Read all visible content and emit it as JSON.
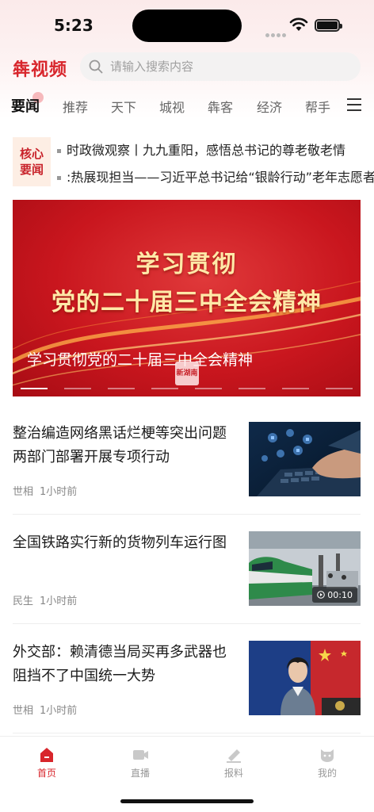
{
  "status_bar": {
    "time": "5:23"
  },
  "header": {
    "logo": "犇视频",
    "search_placeholder": "请输入搜索内容"
  },
  "tabs": [
    {
      "label": "要闻",
      "active": true
    },
    {
      "label": "推荐"
    },
    {
      "label": "天下"
    },
    {
      "label": "城视"
    },
    {
      "label": "犇客"
    },
    {
      "label": "经济"
    },
    {
      "label": "帮手"
    }
  ],
  "core_news": {
    "badge_line1": "核心",
    "badge_line2": "要闻",
    "items": [
      "时政微观察丨九九重阳，感悟总书记的尊老敬老情",
      ":热展现担当——习近平总书记给“银龄行动”老年志愿者"
    ]
  },
  "banner": {
    "line1": "学习贯彻",
    "line2": "党的二十届三中全会精神",
    "caption": "学习贯彻党的二十届三中全会精神",
    "stamp": "新湖南"
  },
  "articles": [
    {
      "title": "整治编造网络黑话烂梗等突出问题 两部门部署开展专项行动",
      "category": "世相",
      "time": "1小时前"
    },
    {
      "title": "全国铁路实行新的货物列车运行图",
      "category": "民生",
      "time": "1小时前",
      "video_duration": "00:10"
    },
    {
      "title": "外交部：赖清德当局买再多武器也阻挡不了中国统一大势",
      "category": "世相",
      "time": "1小时前"
    }
  ],
  "bottom_nav": [
    {
      "label": "首页",
      "icon": "home-icon",
      "active": true
    },
    {
      "label": "直播",
      "icon": "live-icon"
    },
    {
      "label": "报料",
      "icon": "report-icon"
    },
    {
      "label": "我的",
      "icon": "profile-icon"
    }
  ],
  "colors": {
    "accent": "#d8262c",
    "banner_red": "#c9161e",
    "banner_text": "#ffe9a8"
  }
}
